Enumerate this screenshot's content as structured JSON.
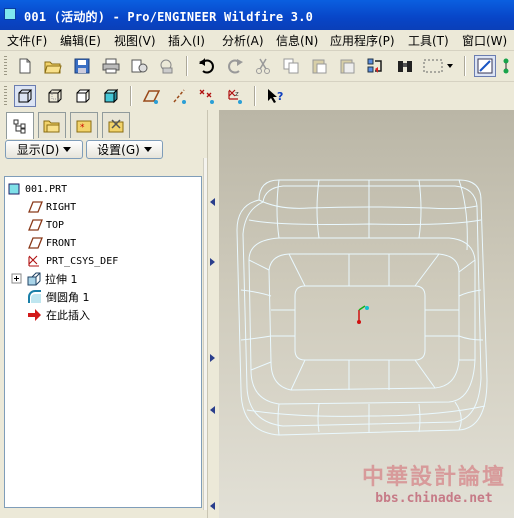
{
  "window": {
    "title": "001 (活动的) - Pro/ENGINEER Wildfire 3.0"
  },
  "menu": [
    "文件(F)",
    "编辑(E)",
    "视图(V)",
    "插入(I)",
    "分析(A)",
    "信息(N)",
    "应用程序(P)",
    "工具(T)",
    "窗口(W)"
  ],
  "panel": {
    "show_label": "显示(D)",
    "settings_label": "设置(G)"
  },
  "tree": {
    "root": "001.PRT",
    "items": [
      {
        "label": "RIGHT"
      },
      {
        "label": "TOP"
      },
      {
        "label": "FRONT"
      },
      {
        "label": "PRT_CSYS_DEF"
      },
      {
        "label": "拉伸 1"
      },
      {
        "label": "倒圆角 1"
      },
      {
        "label": "在此插入"
      }
    ]
  },
  "watermark": {
    "line1": "中華設計論壇",
    "line2": "bbs.chinade.net"
  },
  "colors": {
    "titlebar": "#0A5FE0",
    "wireframe": "#E8F8FF",
    "csys_red": "#D01010",
    "csys_green": "#18B018",
    "csys_cyan": "#10C0D0"
  }
}
